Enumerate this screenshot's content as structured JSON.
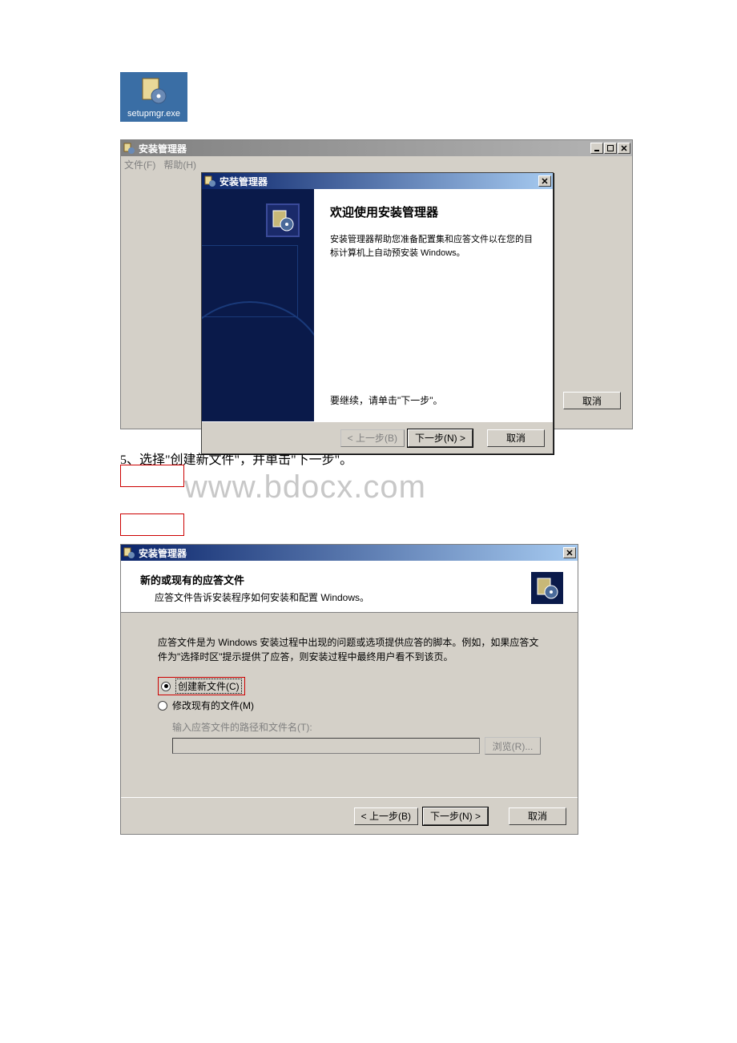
{
  "desktop_icon": {
    "label": "setupmgr.exe",
    "icon_name": "setupmgr-icon"
  },
  "window1": {
    "title": "安装管理器",
    "menu": {
      "file": "文件(F)",
      "help": "帮助(H)"
    },
    "cancel": "取消",
    "sysbuttons": {
      "min": "_",
      "max": "□",
      "close": "✕"
    }
  },
  "wizard1": {
    "title": "安装管理器",
    "heading": "欢迎使用安装管理器",
    "desc": "安装管理器帮助您准备配置集和应答文件以在您的目标计算机上自动预安装 Windows。",
    "continue": "要继续，请单击\"下一步\"。",
    "back": "< 上一步(B)",
    "next": "下一步(N) >",
    "cancel": "取消",
    "close_btn": "✕"
  },
  "step_text": "5、选择\"创建新文件\"，并单击\"下一步\"。",
  "watermark": "www.bdocx.com",
  "window2": {
    "title": "安装管理器",
    "close_btn": "✕",
    "header_title": "新的或现有的应答文件",
    "header_sub": "应答文件告诉安装程序如何安装和配置 Windows。",
    "body_para": "应答文件是为 Windows 安装过程中出现的问题或选项提供应答的脚本。例如，如果应答文件为\"选择时区\"提示提供了应答，则安装过程中最终用户看不到该页。",
    "radio_create": "创建新文件(C)",
    "radio_modify": "修改现有的文件(M)",
    "path_label": "输入应答文件的路径和文件名(T):",
    "path_value": "",
    "browse": "浏览(R)...",
    "back": "< 上一步(B)",
    "next": "下一步(N) >",
    "cancel": "取消"
  }
}
